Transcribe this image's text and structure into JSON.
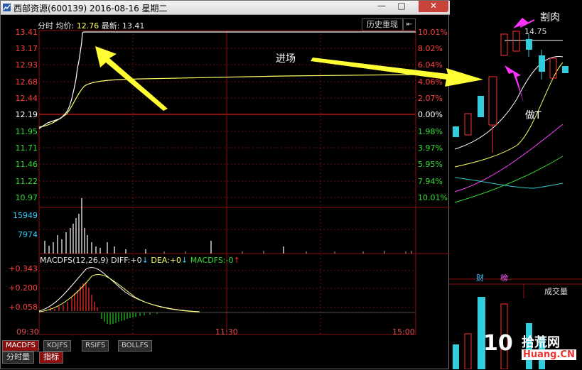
{
  "window": {
    "title": "西部资源(600139) 2016-08-16 星期二",
    "min_glyph": "—",
    "restore_glyph": "□",
    "close_glyph": "✕"
  },
  "header": {
    "label_prefix": "分时 均价:",
    "avg_price": "12.76",
    "latest_label": "最新:",
    "latest_price": "13.41",
    "history_button": "历史重现",
    "back_button": "⇤"
  },
  "price_axis": {
    "left": [
      "13.41",
      "13.17",
      "12.93",
      "12.68",
      "12.44",
      "12.19",
      "11.95",
      "11.71",
      "11.46",
      "11.22",
      "10.97"
    ],
    "right": [
      "10.01%",
      "8.02%",
      "6.04%",
      "4.06%",
      "2.07%",
      "0.00%",
      "1.98%",
      "3.97%",
      "5.95%",
      "7.94%",
      "10.01%"
    ]
  },
  "volume_axis": {
    "top": "15949",
    "mid": "7974"
  },
  "macd": {
    "name": "MACDFS(12,26,9)",
    "diff_label": "DIFF:",
    "diff_value": "+0",
    "dea_label": "DEA:",
    "dea_value": "+0",
    "macdfs_label": "MACDFS:",
    "macdfs_value": "-0",
    "axis": [
      "+0.343",
      "+0.200",
      "+0.058"
    ]
  },
  "time_axis": {
    "start": "09:30",
    "mid": "11:30",
    "end": "15:00"
  },
  "indicator_tabs": [
    "MACDFS",
    "KDJFS",
    "RSIFS",
    "BOLLFS"
  ],
  "bottom_tabs": [
    "分时量",
    "指标"
  ],
  "background_chart": {
    "price_label": "14.75",
    "annotations": {
      "cut": "割肉",
      "enter": "进场",
      "do_t": "做T"
    },
    "badges": [
      "财",
      "榜"
    ],
    "volume_label": "成交量",
    "watermark_main": "拾荒网",
    "watermark_domain": "Huang.CN",
    "watermark_number": "10"
  },
  "colors": {
    "up": "#ff3333",
    "down": "#22cc22",
    "price_line": "#ffffff",
    "avg_line": "#ffff66",
    "accent_cyan": "#33ccff",
    "arrow_yellow": "#ffff33",
    "arrow_magenta": "#ff33ff"
  }
}
